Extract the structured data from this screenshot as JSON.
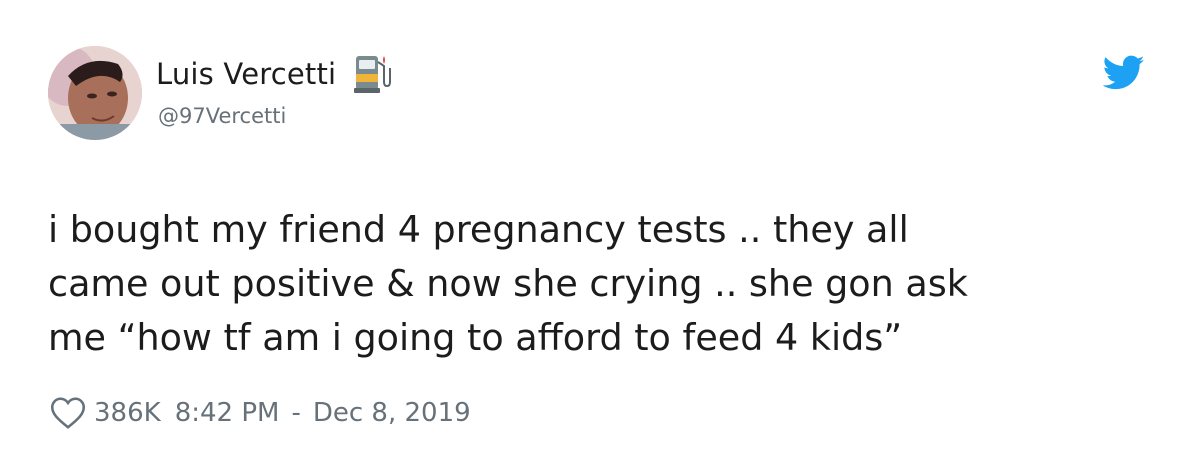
{
  "tweet": {
    "display_name": "Luis Vercetti",
    "handle": "@97Vercetti",
    "name_emoji": "fuel-pump-emoji",
    "body_lines": [
      "i bought my friend 4 pregnancy tests .. they all",
      "came out positive & now she crying .. she gon ask",
      "me “how tf am i going to afford to feed 4 kids”"
    ],
    "likes": "386K",
    "time": "8:42 PM",
    "separator": "-",
    "date": "Dec 8, 2019"
  },
  "colors": {
    "text": "#1c1c1c",
    "muted": "#66717a",
    "twitter_blue": "#1da1f2",
    "background": "#ffffff"
  },
  "icons": {
    "avatar": "avatar",
    "bird": "twitter-bird-icon",
    "heart": "heart-icon"
  }
}
